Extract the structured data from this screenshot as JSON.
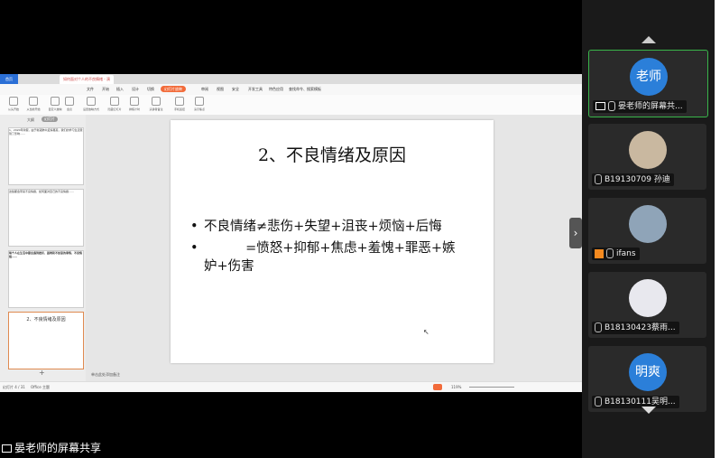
{
  "app": {
    "home_tab": "首页",
    "doc_tab": "如何面对个人的不良情绪 - 演",
    "menus": [
      "文件",
      "开始",
      "插入",
      "设计",
      "切换",
      "动画",
      "幻灯片放映",
      "审阅",
      "视图",
      "安全",
      "开发工具",
      "特色应用",
      "查找命令、搜索模板"
    ],
    "active_menu": "幻灯片放映",
    "toolbar": [
      "从头开始",
      "从当前开始",
      "自定义放映",
      "会议",
      "设置放映方式",
      "隐藏幻灯片",
      "排练计时",
      "演讲者备注",
      "手机遥控",
      "演示焦点"
    ],
    "panel_tabs": [
      "大纲",
      "幻灯片"
    ]
  },
  "thumbnails": [
    {
      "num": "",
      "text": "1、2020年寒假，由于新冠肺炎疫情蔓延，我们的学习生活受到了影响……"
    },
    {
      "num": "",
      "text": "这些都会带来不良情绪，如何面对自己的不良情绪……"
    },
    {
      "num": "3",
      "text": "每个人在生活中都会遇到挫折、困难和不如意的事情，不良情绪……"
    },
    {
      "num": "4",
      "text": "2、不良情绪及原因"
    }
  ],
  "slide": {
    "title": "2、不良情绪及原因",
    "bullets": [
      {
        "line1": "不良情绪≠悲伤+失望+沮丧+烦恼+后悔"
      },
      {
        "line1": "          =愤怒+抑郁+焦虑+羞愧+罪恶+嫉",
        "line2": "妒+伤害"
      }
    ]
  },
  "notes_placeholder": "单击此处添加备注",
  "status": {
    "slide_count": "幻灯片 4 / 31",
    "theme": "Office 主题",
    "zoom": "119%"
  },
  "participants": [
    {
      "avatar_text": "老师",
      "label": "晏老师的屏幕共...",
      "active": true
    },
    {
      "avatar_text": "",
      "label": "B19130709 孙迪",
      "active": false
    },
    {
      "avatar_text": "",
      "label": "ifans",
      "active": false
    },
    {
      "avatar_text": "",
      "label": "B18130423蔡雨...",
      "active": false
    },
    {
      "avatar_text": "明爽",
      "label": "B18130111吴明...",
      "active": false
    }
  ],
  "caption": "晏老师的屏幕共享",
  "colors": {
    "accent": "#f26b3a",
    "active_border": "#39b54a",
    "avatar_blue": "#2b7fd9"
  }
}
